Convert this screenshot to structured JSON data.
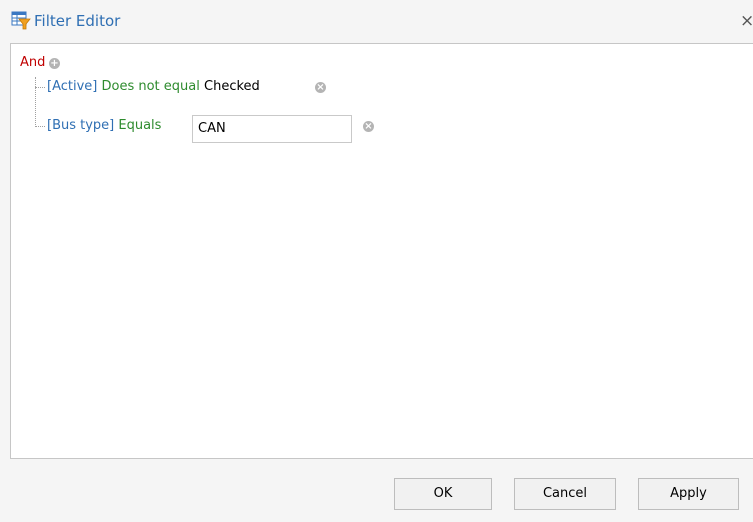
{
  "window": {
    "title": "Filter Editor",
    "close_glyph": "×",
    "title_icon": "filter-table-icon"
  },
  "filter": {
    "group_operator": "And",
    "add_glyph": "+",
    "remove_glyph": "×",
    "conditions": [
      {
        "field": "[Active]",
        "operator": "Does not equal",
        "value": "Checked"
      },
      {
        "field": "[Bus type]",
        "operator": "Equals",
        "value": "CAN"
      }
    ]
  },
  "buttons": {
    "ok": "OK",
    "cancel": "Cancel",
    "apply": "Apply"
  },
  "colors": {
    "title": "#2f6fb3",
    "group_operator": "#c00000",
    "field": "#2f6fb3",
    "operator": "#2e8b2e"
  }
}
